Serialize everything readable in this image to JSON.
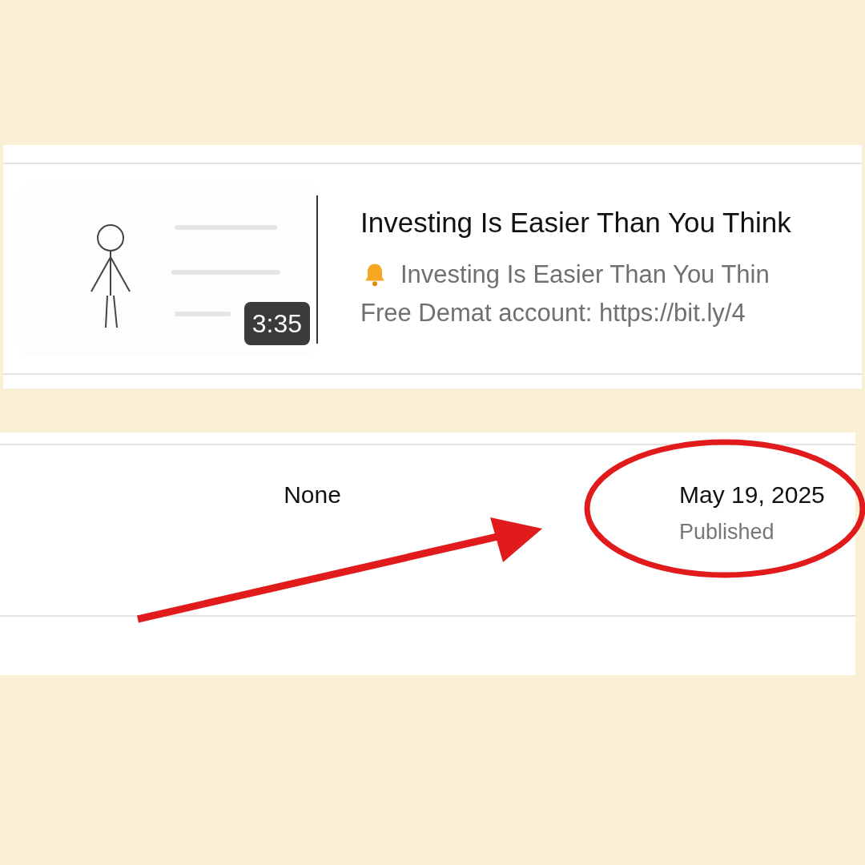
{
  "video": {
    "duration": "3:35",
    "title": "Investing Is Easier Than You Think",
    "description": [
      "Investing Is Easier Than You Thin",
      "Free Demat account: https://bit.ly/4"
    ]
  },
  "row": {
    "column_1": "None",
    "date": "May 19, 2025",
    "status": "Published"
  }
}
